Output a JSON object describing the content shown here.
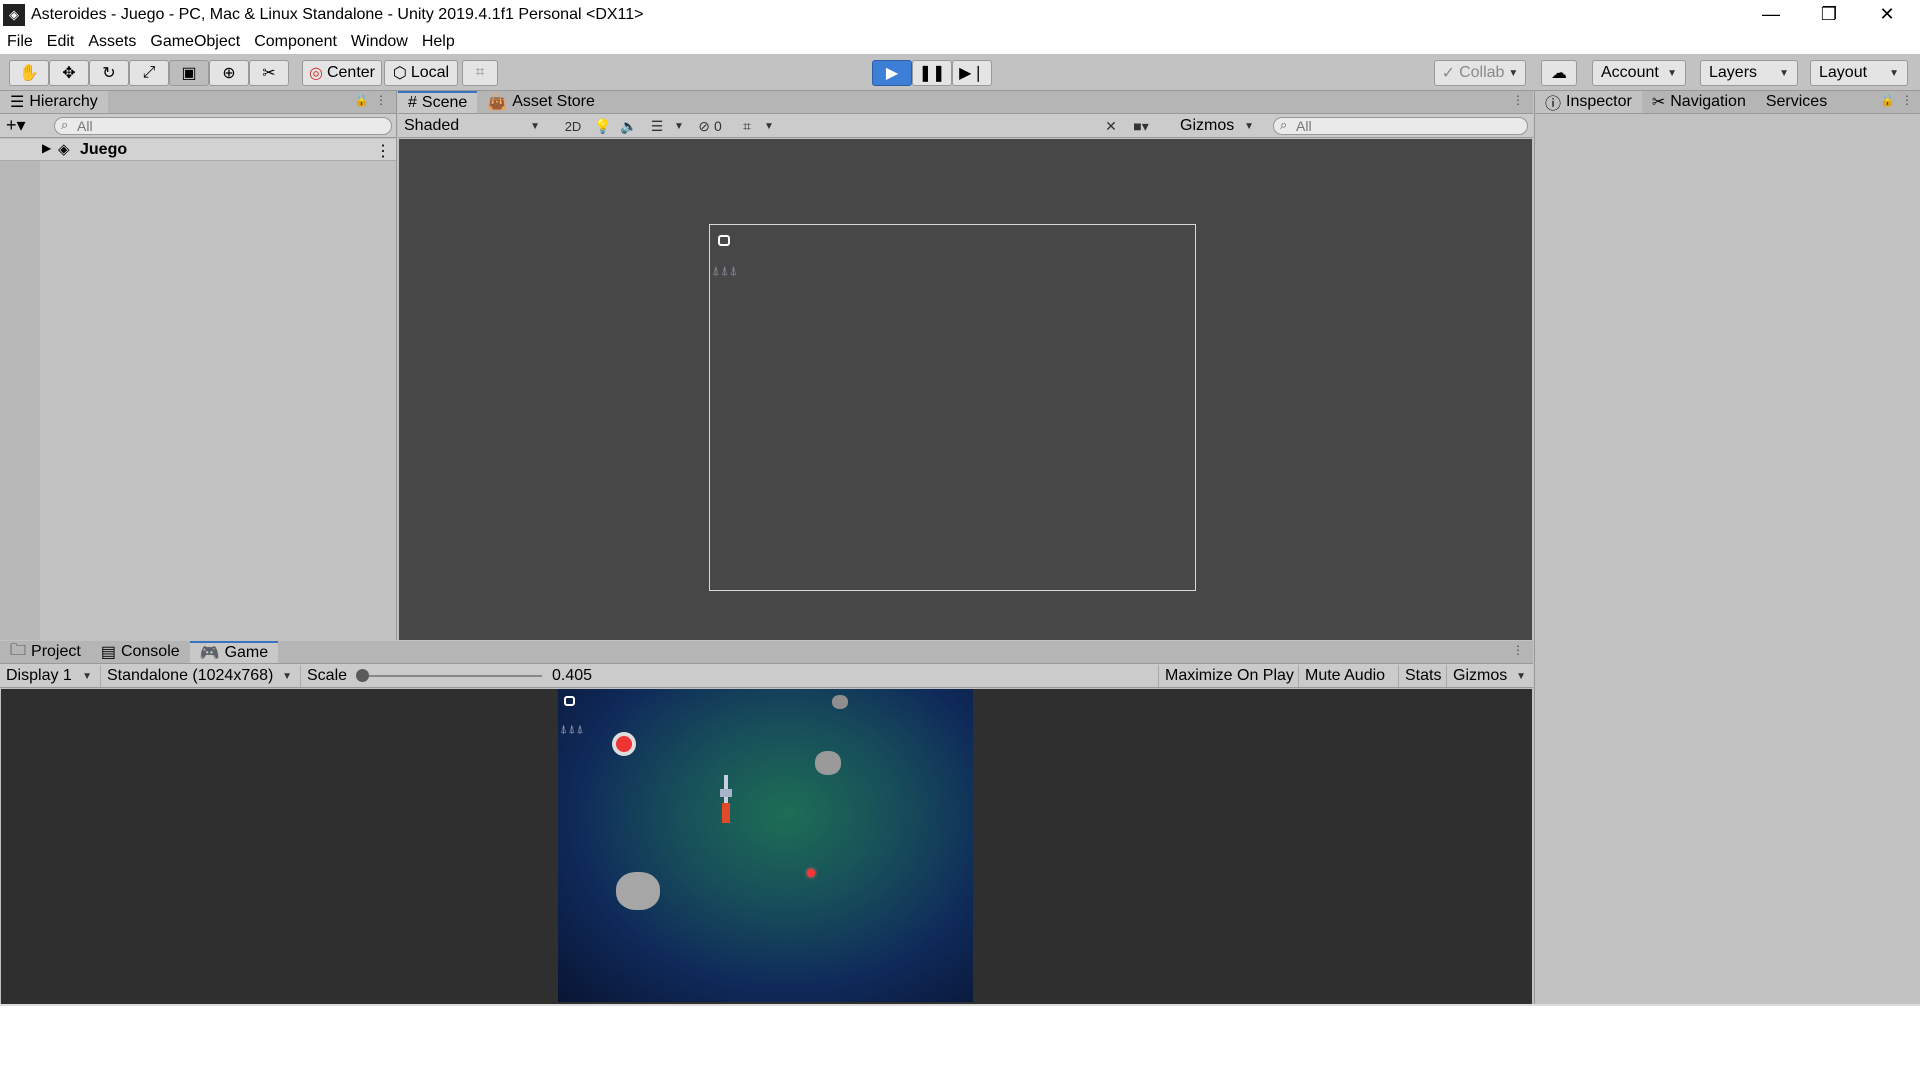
{
  "window": {
    "title": "Asteroides - Juego - PC, Mac & Linux Standalone - Unity 2019.4.1f1 Personal <DX11>",
    "controls": [
      "—",
      "❐",
      "✕"
    ]
  },
  "menu": [
    "File",
    "Edit",
    "Assets",
    "GameObject",
    "Component",
    "Window",
    "Help"
  ],
  "toolbar": {
    "tools": [
      "hand-icon",
      "move-icon",
      "rotate-icon",
      "scale-icon",
      "rect-tool-icon",
      "transform-icon",
      "custom-tool-icon"
    ],
    "pivot": "Center",
    "space": "Local",
    "collab": "Collab",
    "account": "Account",
    "layers": "Layers",
    "layout": "Layout",
    "play_state": "playing"
  },
  "hierarchy": {
    "tab": "Hierarchy",
    "search_placeholder": "All",
    "items": [
      {
        "label": "Juego"
      }
    ]
  },
  "scene": {
    "tabs": [
      "Scene",
      "Asset Store"
    ],
    "shading": "Shaded",
    "mode_2d": "2D",
    "hidden_count": "0",
    "gizmos": "Gizmos",
    "search_placeholder": "All"
  },
  "inspector": {
    "tabs": [
      "Inspector",
      "Navigation",
      "Services"
    ]
  },
  "bottom": {
    "tabs": [
      "Project",
      "Console",
      "Game"
    ],
    "display": "Display 1",
    "resolution": "Standalone (1024x768)",
    "scale_label": "Scale",
    "scale_value": "0.405",
    "buttons": [
      "Maximize On Play",
      "Mute Audio",
      "Stats",
      "Gizmos"
    ]
  },
  "colors": {
    "play_active": "#3d7ed6",
    "scene_bg": "#474747",
    "game_bg": "#2f2f2f"
  }
}
